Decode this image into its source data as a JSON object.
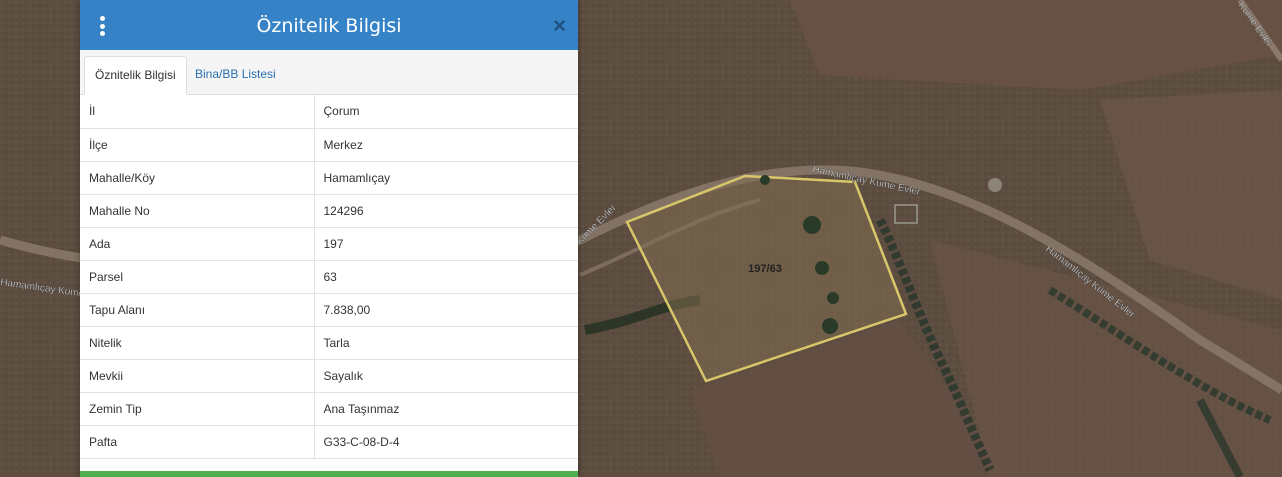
{
  "panel": {
    "title": "Öznitelik Bilgisi",
    "close_label": "×",
    "tabs": [
      {
        "label": "Öznitelik Bilgisi",
        "active": true
      },
      {
        "label": "Bina/BB Listesi",
        "active": false
      }
    ],
    "rows": [
      {
        "key": "İl",
        "value": "Çorum"
      },
      {
        "key": "İlçe",
        "value": "Merkez"
      },
      {
        "key": "Mahalle/Köy",
        "value": "Hamamlıçay"
      },
      {
        "key": "Mahalle No",
        "value": "124296"
      },
      {
        "key": "Ada",
        "value": "197"
      },
      {
        "key": "Parsel",
        "value": "63"
      },
      {
        "key": "Tapu Alanı",
        "value": "7.838,00"
      },
      {
        "key": "Nitelik",
        "value": "Tarla"
      },
      {
        "key": "Mevkii",
        "value": "Sayalık"
      },
      {
        "key": "Zemin Tip",
        "value": "Ana Taşınmaz"
      },
      {
        "key": "Pafta",
        "value": "G33-C-08-D-4"
      }
    ]
  },
  "map": {
    "parcel_label": "197/63",
    "road_labels": [
      "Hamamlıçay Küme Evler",
      "Hamamlıçay Küme Evler",
      "Küme Evler",
      "Hamamlıçay Küme",
      "Küme Evler"
    ],
    "parcel_color": "#d8c66a"
  }
}
